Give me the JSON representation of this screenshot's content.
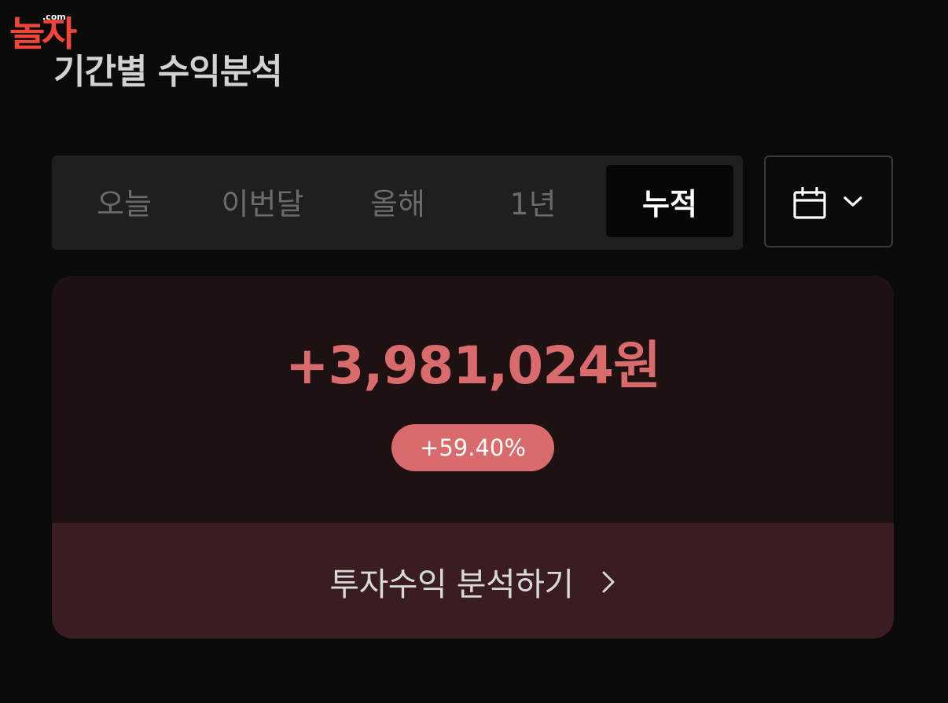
{
  "logo": {
    "dotcom": ".com",
    "mark": "놀자"
  },
  "page": {
    "title": "기간별 수익분석"
  },
  "period_tabs": {
    "items": [
      {
        "label": "오늘",
        "selected": false
      },
      {
        "label": "이번달",
        "selected": false
      },
      {
        "label": "올해",
        "selected": false
      },
      {
        "label": "1년",
        "selected": false
      },
      {
        "label": "누적",
        "selected": true
      }
    ]
  },
  "date_picker": {
    "icon": "calendar-icon",
    "dropdown_icon": "chevron-down-icon"
  },
  "summary": {
    "amount": "+3,981,024원",
    "rate": "+59.40%",
    "action_label": "투자수익 분석하기",
    "action_icon": "chevron-right-icon"
  },
  "colors": {
    "background": "#0a0a0a",
    "profit": "#d96b6d",
    "card_top": "#1e1112",
    "card_bottom": "#3a1d20",
    "logo": "#f0453a"
  }
}
